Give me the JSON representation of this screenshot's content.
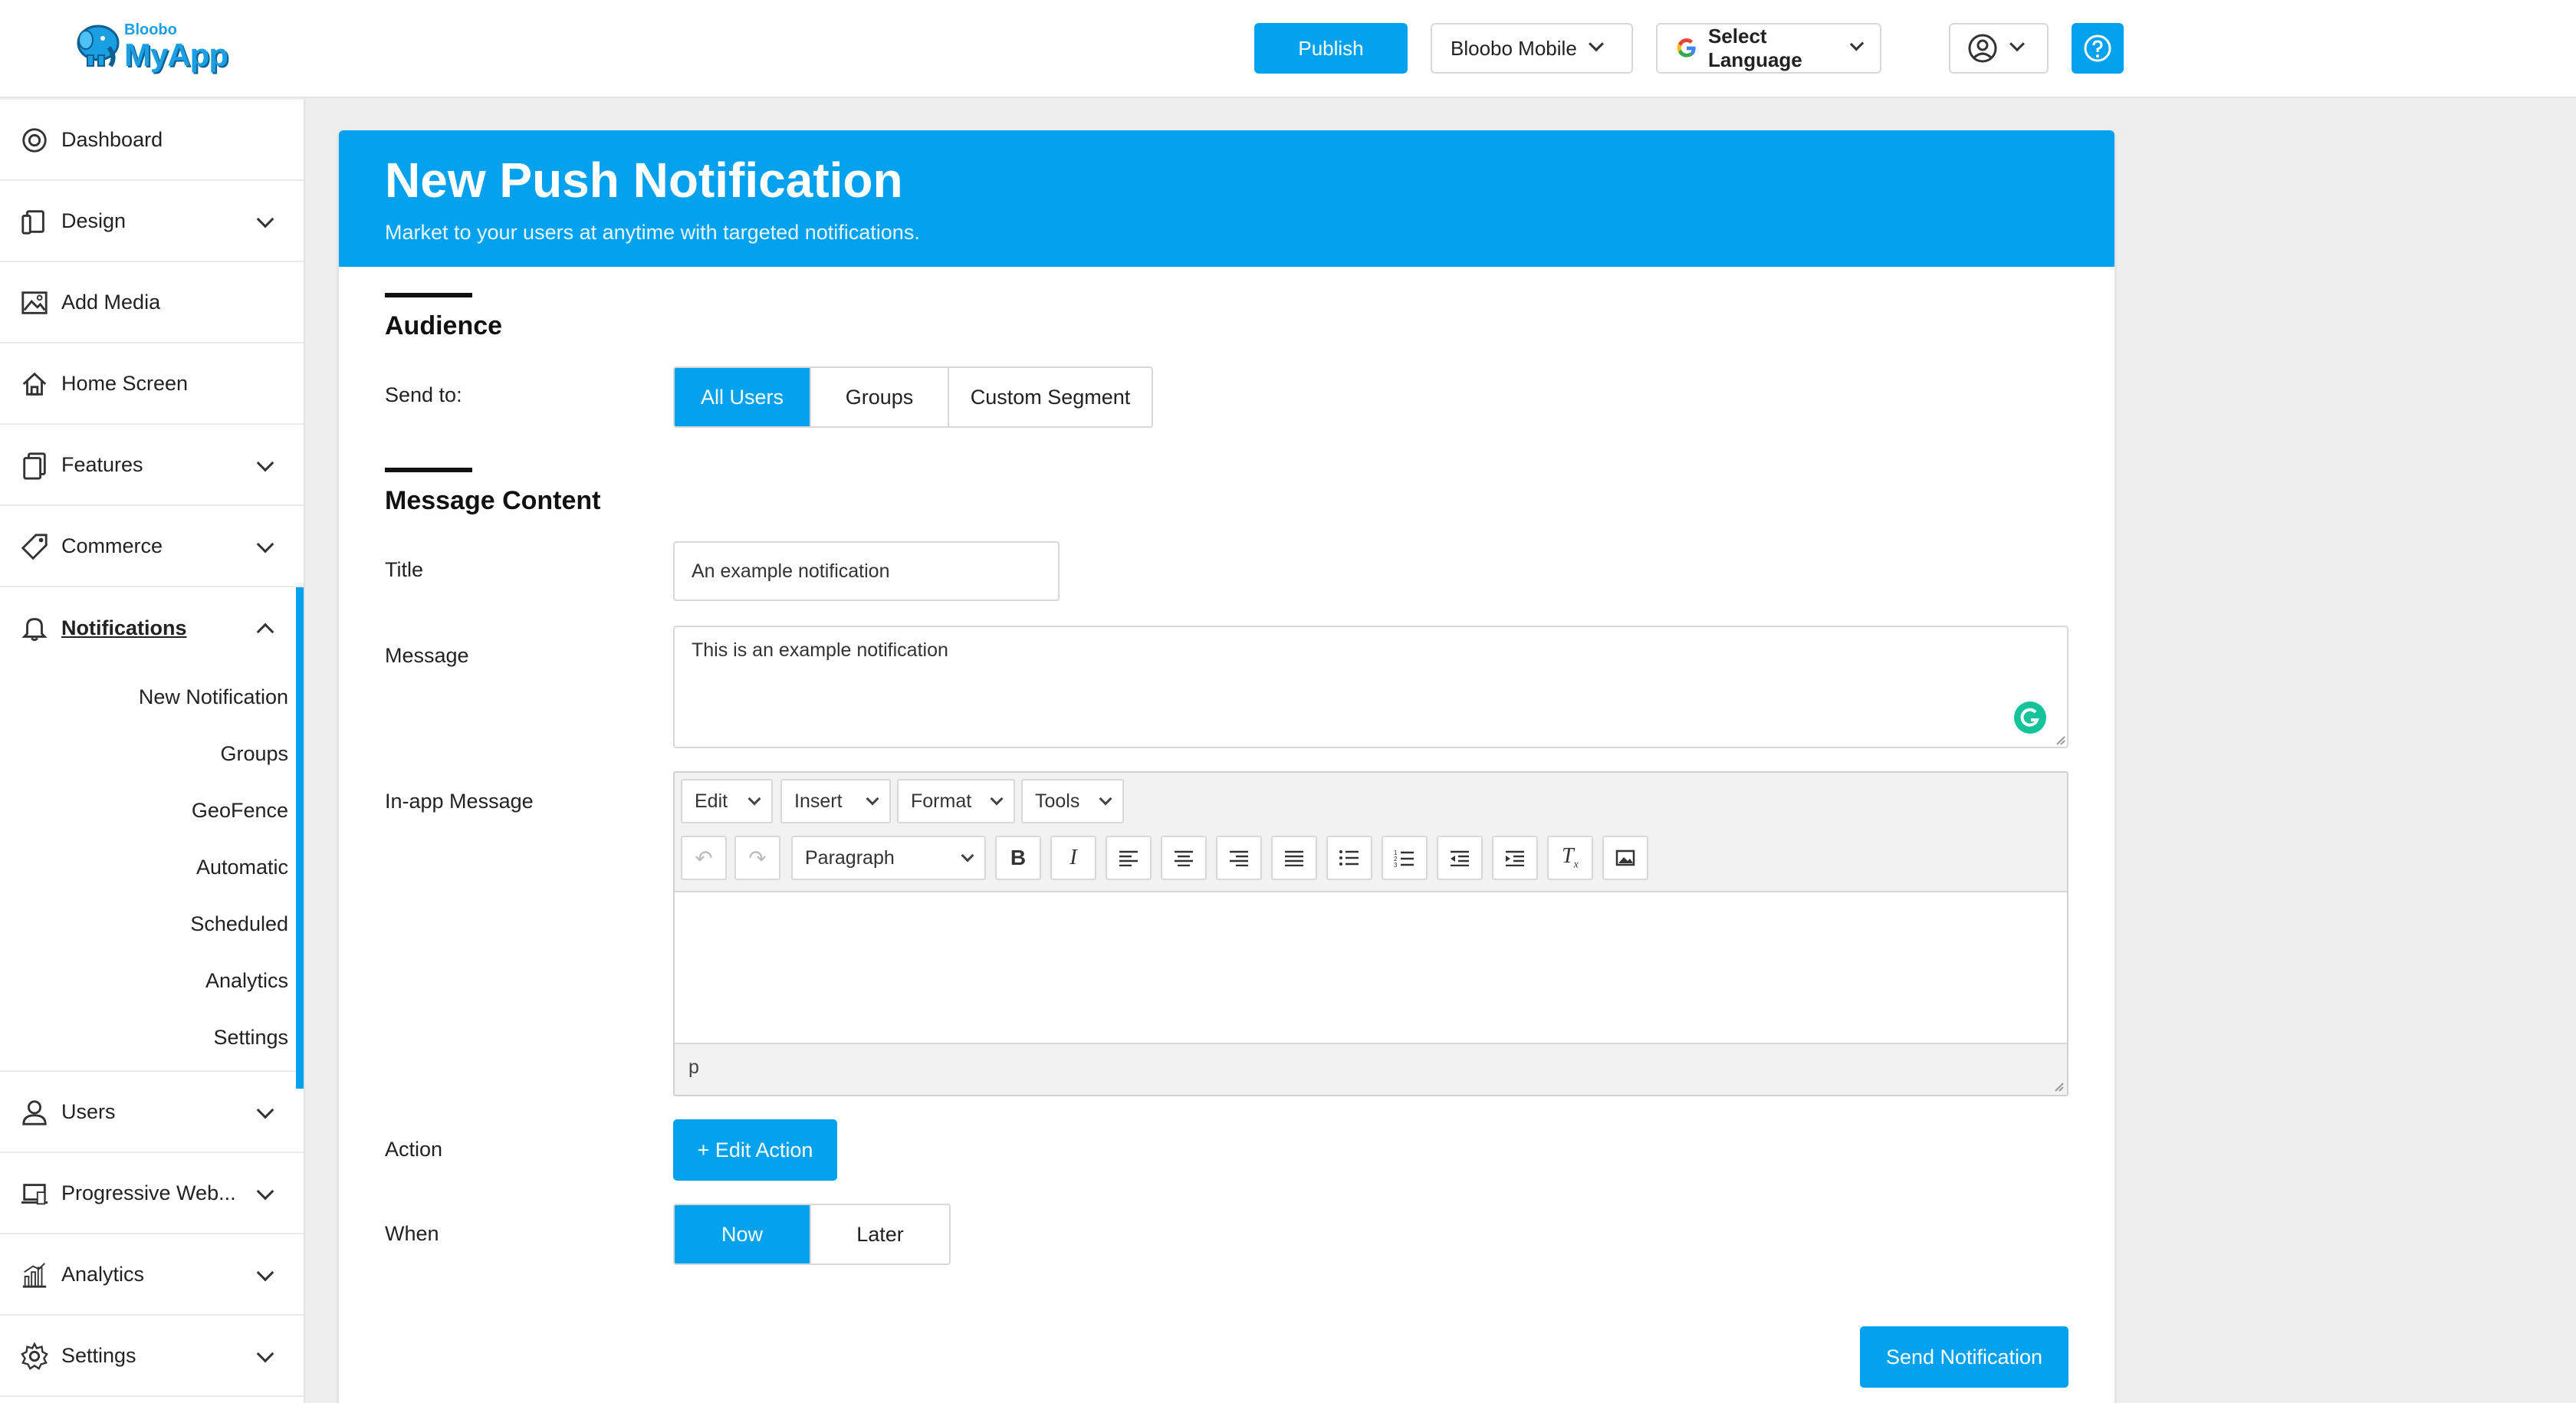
{
  "header": {
    "logo_small": "Bloobo",
    "logo_big": "MyApp",
    "publish_label": "Publish",
    "app_selector": "Bloobo Mobile",
    "language_selector": "Select Language"
  },
  "sidebar": {
    "items": [
      {
        "label": "Dashboard",
        "icon": "dashboard-icon"
      },
      {
        "label": "Design",
        "icon": "design-icon"
      },
      {
        "label": "Add Media",
        "icon": "image-icon"
      },
      {
        "label": "Home Screen",
        "icon": "home-icon"
      },
      {
        "label": "Features",
        "icon": "features-icon"
      },
      {
        "label": "Commerce",
        "icon": "tag-icon"
      },
      {
        "label": "Notifications",
        "icon": "bell-icon"
      },
      {
        "label": "Users",
        "icon": "user-icon"
      },
      {
        "label": "Progressive Web...",
        "icon": "laptop-icon"
      },
      {
        "label": "Analytics",
        "icon": "chart-icon"
      },
      {
        "label": "Settings",
        "icon": "gear-icon"
      }
    ],
    "notifications_sub": [
      "New Notification",
      "Groups",
      "GeoFence",
      "Automatic",
      "Scheduled",
      "Analytics",
      "Settings"
    ]
  },
  "card": {
    "title": "New Push Notification",
    "subtitle": "Market to your users at anytime with targeted notifications."
  },
  "audience": {
    "section_title": "Audience",
    "send_to_label": "Send to:",
    "options": [
      "All Users",
      "Groups",
      "Custom Segment"
    ],
    "selected": "All Users"
  },
  "content": {
    "section_title": "Message Content",
    "title_label": "Title",
    "title_value": "An example notification",
    "message_label": "Message",
    "message_value": "This is an example notification",
    "inapp_label": "In-app Message",
    "menus": [
      "Edit",
      "Insert",
      "Format",
      "Tools"
    ],
    "block_format": "Paragraph",
    "status_path": "p"
  },
  "action": {
    "label": "Action",
    "button": "+ Edit Action"
  },
  "when": {
    "label": "When",
    "options": [
      "Now",
      "Later"
    ],
    "selected": "Now"
  },
  "submit_label": "Send Notification",
  "colors": {
    "accent": "#03a1ee",
    "grammarly": "#15c39a"
  }
}
